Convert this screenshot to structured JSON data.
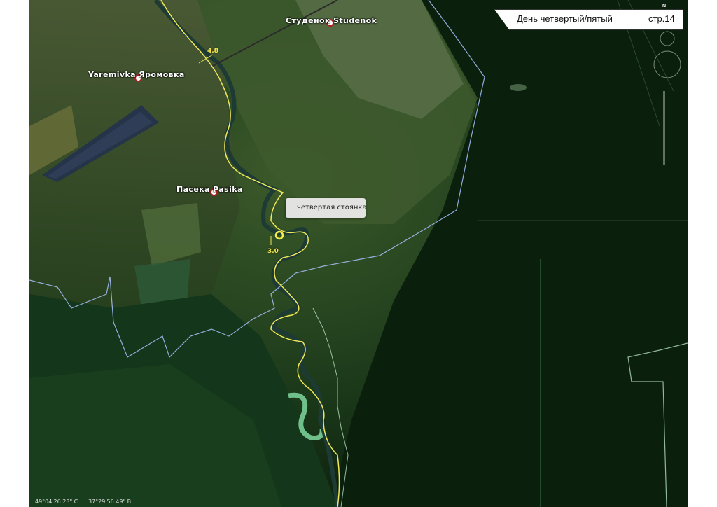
{
  "header": {
    "title": "День четвертый/пятый",
    "page": "стр.14"
  },
  "places": {
    "studenok": "Студенок Studenok",
    "yaremivka": "Yaremivka Яромовка",
    "pasika": "Пасека Pasika"
  },
  "markers": {
    "km_4_8": "4.8",
    "km_3_0": "3.0"
  },
  "callout": {
    "label": "четвертая стоянка"
  },
  "status": {
    "lat": "49°04'26.23\" С",
    "lon": "37°29'56.49\" В"
  },
  "compass": {
    "north": "N"
  },
  "colors": {
    "route": "#f0e85a",
    "border": "#a8c4ff",
    "river": "#1e3a3a",
    "header_bg": "#ffffff"
  }
}
